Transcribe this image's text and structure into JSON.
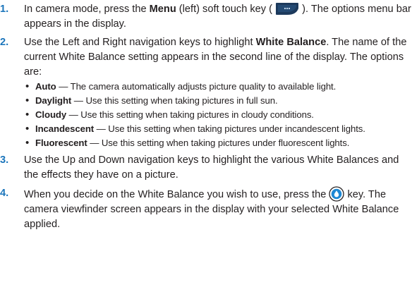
{
  "steps": [
    {
      "num": "1.",
      "parts": [
        {
          "text": "In camera mode, press the ",
          "bold": false
        },
        {
          "text": "Menu",
          "bold": true
        },
        {
          "text": " (left) soft touch key (",
          "bold": false
        },
        {
          "icon": "menu-soft-key-icon"
        },
        {
          "text": "). The options menu bar appears in the display.",
          "bold": false
        }
      ]
    },
    {
      "num": "2.",
      "parts": [
        {
          "text": "Use the Left and Right navigation keys to highlight ",
          "bold": false
        },
        {
          "text": "White Balance",
          "bold": true
        },
        {
          "text": ". The name of the current White Balance setting appears in the second line of the display. The options are:",
          "bold": false
        }
      ],
      "options": [
        {
          "name": "Auto",
          "desc": " — The camera automatically adjusts picture quality to available light."
        },
        {
          "name": "Daylight",
          "desc": " — Use this setting when taking pictures in full sun."
        },
        {
          "name": "Cloudy",
          "desc": " — Use this setting when taking pictures in cloudy conditions."
        },
        {
          "name": "Incandescent",
          "desc": " — Use this setting when taking pictures under incandescent lights."
        },
        {
          "name": "Fluorescent",
          "desc": " — Use this setting when taking pictures under fluorescent lights."
        }
      ]
    },
    {
      "num": "3.",
      "parts": [
        {
          "text": "Use the Up and Down navigation keys to highlight the various White Balances and the effects they have on a picture.",
          "bold": false
        }
      ]
    },
    {
      "num": "4.",
      "parts": [
        {
          "text": "When you decide on the White Balance you wish to use, press the ",
          "bold": false
        },
        {
          "icon": "ok-key-icon"
        },
        {
          "text": " key. The camera viewfinder screen appears in the display with your selected White Balance applied.",
          "bold": false
        }
      ]
    }
  ],
  "bullet": "•",
  "colors": {
    "step_number": "#1b75bb",
    "menu_key": "#1d3a5c",
    "ok_key_fill": "#1e88d4"
  }
}
